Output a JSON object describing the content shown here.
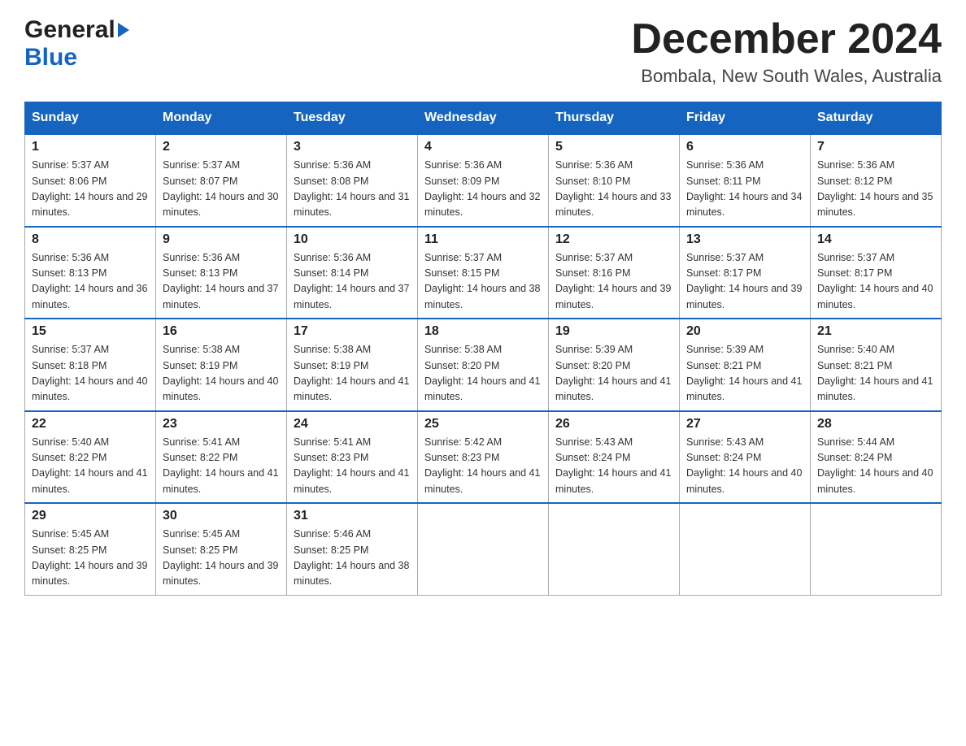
{
  "header": {
    "logo_general": "General",
    "logo_blue": "Blue",
    "page_title": "December 2024",
    "subtitle": "Bombala, New South Wales, Australia"
  },
  "weekdays": [
    "Sunday",
    "Monday",
    "Tuesday",
    "Wednesday",
    "Thursday",
    "Friday",
    "Saturday"
  ],
  "weeks": [
    [
      {
        "day": "1",
        "sunrise": "5:37 AM",
        "sunset": "8:06 PM",
        "daylight": "14 hours and 29 minutes."
      },
      {
        "day": "2",
        "sunrise": "5:37 AM",
        "sunset": "8:07 PM",
        "daylight": "14 hours and 30 minutes."
      },
      {
        "day": "3",
        "sunrise": "5:36 AM",
        "sunset": "8:08 PM",
        "daylight": "14 hours and 31 minutes."
      },
      {
        "day": "4",
        "sunrise": "5:36 AM",
        "sunset": "8:09 PM",
        "daylight": "14 hours and 32 minutes."
      },
      {
        "day": "5",
        "sunrise": "5:36 AM",
        "sunset": "8:10 PM",
        "daylight": "14 hours and 33 minutes."
      },
      {
        "day": "6",
        "sunrise": "5:36 AM",
        "sunset": "8:11 PM",
        "daylight": "14 hours and 34 minutes."
      },
      {
        "day": "7",
        "sunrise": "5:36 AM",
        "sunset": "8:12 PM",
        "daylight": "14 hours and 35 minutes."
      }
    ],
    [
      {
        "day": "8",
        "sunrise": "5:36 AM",
        "sunset": "8:13 PM",
        "daylight": "14 hours and 36 minutes."
      },
      {
        "day": "9",
        "sunrise": "5:36 AM",
        "sunset": "8:13 PM",
        "daylight": "14 hours and 37 minutes."
      },
      {
        "day": "10",
        "sunrise": "5:36 AM",
        "sunset": "8:14 PM",
        "daylight": "14 hours and 37 minutes."
      },
      {
        "day": "11",
        "sunrise": "5:37 AM",
        "sunset": "8:15 PM",
        "daylight": "14 hours and 38 minutes."
      },
      {
        "day": "12",
        "sunrise": "5:37 AM",
        "sunset": "8:16 PM",
        "daylight": "14 hours and 39 minutes."
      },
      {
        "day": "13",
        "sunrise": "5:37 AM",
        "sunset": "8:17 PM",
        "daylight": "14 hours and 39 minutes."
      },
      {
        "day": "14",
        "sunrise": "5:37 AM",
        "sunset": "8:17 PM",
        "daylight": "14 hours and 40 minutes."
      }
    ],
    [
      {
        "day": "15",
        "sunrise": "5:37 AM",
        "sunset": "8:18 PM",
        "daylight": "14 hours and 40 minutes."
      },
      {
        "day": "16",
        "sunrise": "5:38 AM",
        "sunset": "8:19 PM",
        "daylight": "14 hours and 40 minutes."
      },
      {
        "day": "17",
        "sunrise": "5:38 AM",
        "sunset": "8:19 PM",
        "daylight": "14 hours and 41 minutes."
      },
      {
        "day": "18",
        "sunrise": "5:38 AM",
        "sunset": "8:20 PM",
        "daylight": "14 hours and 41 minutes."
      },
      {
        "day": "19",
        "sunrise": "5:39 AM",
        "sunset": "8:20 PM",
        "daylight": "14 hours and 41 minutes."
      },
      {
        "day": "20",
        "sunrise": "5:39 AM",
        "sunset": "8:21 PM",
        "daylight": "14 hours and 41 minutes."
      },
      {
        "day": "21",
        "sunrise": "5:40 AM",
        "sunset": "8:21 PM",
        "daylight": "14 hours and 41 minutes."
      }
    ],
    [
      {
        "day": "22",
        "sunrise": "5:40 AM",
        "sunset": "8:22 PM",
        "daylight": "14 hours and 41 minutes."
      },
      {
        "day": "23",
        "sunrise": "5:41 AM",
        "sunset": "8:22 PM",
        "daylight": "14 hours and 41 minutes."
      },
      {
        "day": "24",
        "sunrise": "5:41 AM",
        "sunset": "8:23 PM",
        "daylight": "14 hours and 41 minutes."
      },
      {
        "day": "25",
        "sunrise": "5:42 AM",
        "sunset": "8:23 PM",
        "daylight": "14 hours and 41 minutes."
      },
      {
        "day": "26",
        "sunrise": "5:43 AM",
        "sunset": "8:24 PM",
        "daylight": "14 hours and 41 minutes."
      },
      {
        "day": "27",
        "sunrise": "5:43 AM",
        "sunset": "8:24 PM",
        "daylight": "14 hours and 40 minutes."
      },
      {
        "day": "28",
        "sunrise": "5:44 AM",
        "sunset": "8:24 PM",
        "daylight": "14 hours and 40 minutes."
      }
    ],
    [
      {
        "day": "29",
        "sunrise": "5:45 AM",
        "sunset": "8:25 PM",
        "daylight": "14 hours and 39 minutes."
      },
      {
        "day": "30",
        "sunrise": "5:45 AM",
        "sunset": "8:25 PM",
        "daylight": "14 hours and 39 minutes."
      },
      {
        "day": "31",
        "sunrise": "5:46 AM",
        "sunset": "8:25 PM",
        "daylight": "14 hours and 38 minutes."
      },
      null,
      null,
      null,
      null
    ]
  ]
}
